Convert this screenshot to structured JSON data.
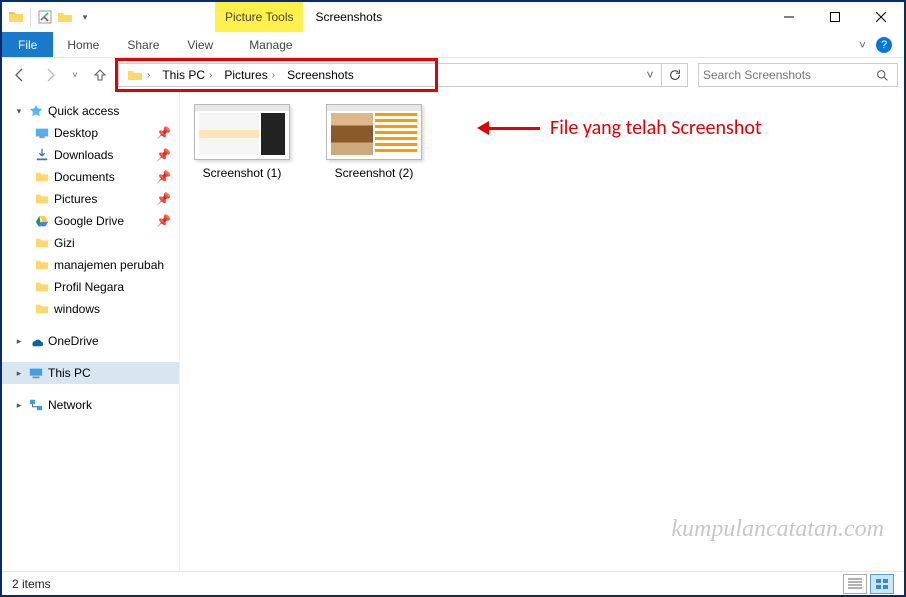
{
  "titlebar": {
    "context_tab_label": "Picture Tools",
    "title": "Screenshots"
  },
  "ribbon": {
    "file": "File",
    "home": "Home",
    "share": "Share",
    "view": "View",
    "manage": "Manage"
  },
  "breadcrumb": {
    "items": [
      "This PC",
      "Pictures",
      "Screenshots"
    ]
  },
  "search": {
    "placeholder": "Search Screenshots"
  },
  "sidebar": {
    "quick_access": "Quick access",
    "items": [
      {
        "label": "Desktop",
        "pinned": true
      },
      {
        "label": "Downloads",
        "pinned": true
      },
      {
        "label": "Documents",
        "pinned": true
      },
      {
        "label": "Pictures",
        "pinned": true
      },
      {
        "label": "Google Drive",
        "pinned": true
      },
      {
        "label": "Gizi",
        "pinned": false
      },
      {
        "label": "manajemen perubah",
        "pinned": false
      },
      {
        "label": "Profil Negara",
        "pinned": false
      },
      {
        "label": "windows",
        "pinned": false
      }
    ],
    "onedrive": "OneDrive",
    "this_pc": "This PC",
    "network": "Network"
  },
  "files": {
    "items": [
      {
        "name": "Screenshot (1)"
      },
      {
        "name": "Screenshot (2)"
      }
    ]
  },
  "annotation": {
    "text": "File yang telah Screenshot"
  },
  "watermark": "kumpulancatatan.com",
  "statusbar": {
    "count_label": "2 items"
  }
}
